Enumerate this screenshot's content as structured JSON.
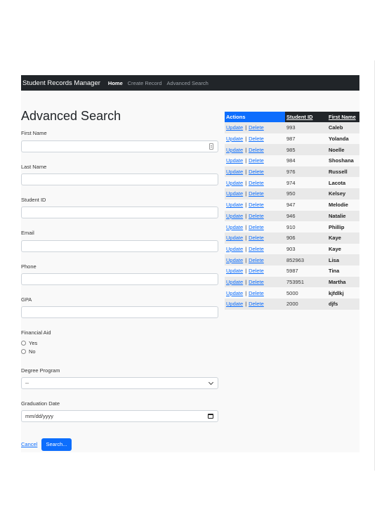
{
  "navbar": {
    "brand": "Student Records Manager",
    "links": [
      "Home",
      "Create Record",
      "Advanced Search"
    ]
  },
  "page_title": "Advanced Search",
  "form": {
    "first_name": {
      "label": "First Name",
      "value": ""
    },
    "last_name": {
      "label": "Last Name",
      "value": ""
    },
    "student_id": {
      "label": "Student ID",
      "value": ""
    },
    "email": {
      "label": "Email",
      "value": ""
    },
    "phone": {
      "label": "Phone",
      "value": ""
    },
    "gpa": {
      "label": "GPA",
      "value": ""
    },
    "financial_aid": {
      "label": "Financial Aid",
      "options": [
        "Yes",
        "No"
      ]
    },
    "degree_program": {
      "label": "Degree Program",
      "selected": "--"
    },
    "graduation_date": {
      "label": "Graduation Date",
      "placeholder": "mm/dd/yyyy"
    },
    "cancel_label": "Cancel",
    "search_label": "Search..."
  },
  "table": {
    "headers": [
      "Actions",
      "Student ID",
      "First Name"
    ],
    "update_label": "Update",
    "separator": "|",
    "delete_label": "Delete",
    "rows": [
      {
        "id": "993",
        "name": "Caleb"
      },
      {
        "id": "987",
        "name": "Yolanda"
      },
      {
        "id": "985",
        "name": "Noelle"
      },
      {
        "id": "984",
        "name": "Shoshana"
      },
      {
        "id": "976",
        "name": "Russell"
      },
      {
        "id": "974",
        "name": "Lacota"
      },
      {
        "id": "950",
        "name": "Kelsey"
      },
      {
        "id": "947",
        "name": "Melodie"
      },
      {
        "id": "946",
        "name": "Natalie"
      },
      {
        "id": "910",
        "name": "Phillip"
      },
      {
        "id": "906",
        "name": "Kaye"
      },
      {
        "id": "903",
        "name": "Kaye"
      },
      {
        "id": "852963",
        "name": "Lisa"
      },
      {
        "id": "5987",
        "name": "Tina"
      },
      {
        "id": "753951",
        "name": "Martha"
      },
      {
        "id": "5000",
        "name": "kjfdlkj"
      },
      {
        "id": "2000",
        "name": "djfs"
      }
    ]
  },
  "colors": {
    "navbar_bg": "#212529",
    "accent": "#0d6efd",
    "row_stripe": "#e9e9e9"
  }
}
